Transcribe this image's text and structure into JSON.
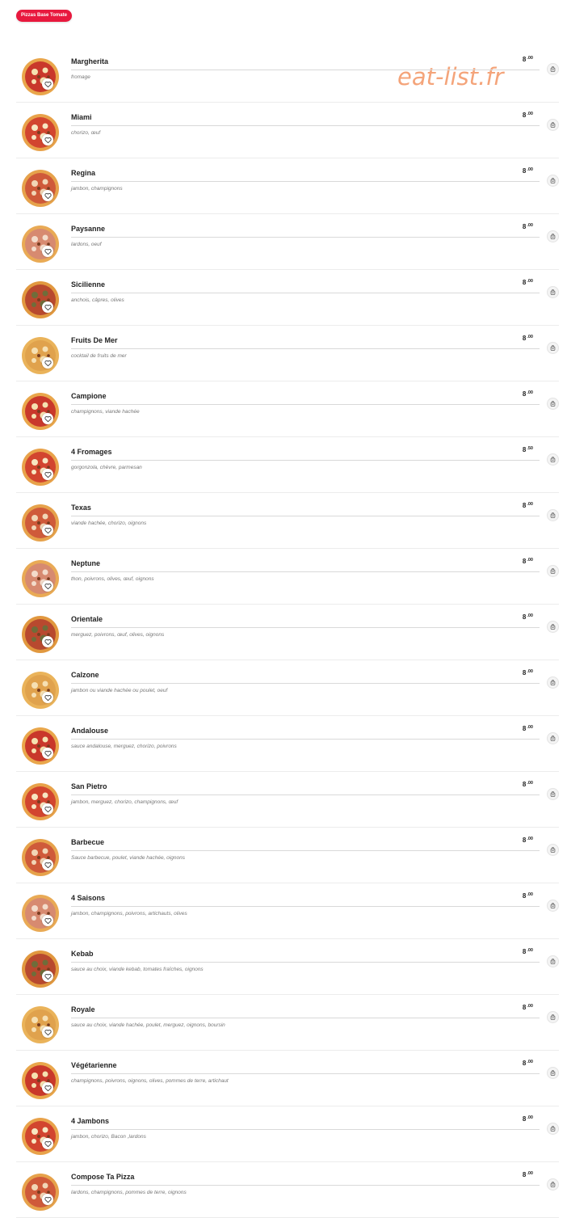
{
  "category": {
    "label": "Pizzas Base Tomate"
  },
  "watermark": "eat-list.fr",
  "items": [
    {
      "name": "Margherita",
      "description": "fromage",
      "price_main": "8",
      "price_cents": ".00"
    },
    {
      "name": "Miami",
      "description": "chorizo, œuf",
      "price_main": "8",
      "price_cents": ".00"
    },
    {
      "name": "Regina",
      "description": "jambon, champignons",
      "price_main": "8",
      "price_cents": ".00"
    },
    {
      "name": "Paysanne",
      "description": "lardons, oeuf",
      "price_main": "8",
      "price_cents": ".00"
    },
    {
      "name": "Sicilienne",
      "description": "anchois, câpres, olives",
      "price_main": "8",
      "price_cents": ".00"
    },
    {
      "name": "Fruits De Mer",
      "description": "cocktail de fruits de mer",
      "price_main": "8",
      "price_cents": ".00"
    },
    {
      "name": "Campione",
      "description": "champignons, viande hachée",
      "price_main": "8",
      "price_cents": ".00"
    },
    {
      "name": "4 Fromages",
      "description": "gorgonzola, chèvre, parmesan",
      "price_main": "8",
      "price_cents": ".50"
    },
    {
      "name": "Texas",
      "description": "viande hachée, chorizo, oignons",
      "price_main": "8",
      "price_cents": ".00"
    },
    {
      "name": "Neptune",
      "description": "thon, poivrons, olives, œuf, oignons",
      "price_main": "8",
      "price_cents": ".00"
    },
    {
      "name": "Orientale",
      "description": "merguez, poivrons, œuf, olives, oignons",
      "price_main": "8",
      "price_cents": ".00"
    },
    {
      "name": "Calzone",
      "description": "jambon ou viande hachée ou poulet, oeuf",
      "price_main": "8",
      "price_cents": ".00"
    },
    {
      "name": "Andalouse",
      "description": "sauce andalouse, merguez, chorizo, poivrons",
      "price_main": "8",
      "price_cents": ".00"
    },
    {
      "name": "San Pietro",
      "description": "jambon, merguez, chorizo, champignons, œuf",
      "price_main": "8",
      "price_cents": ".00"
    },
    {
      "name": "Barbecue",
      "description": "Sauce barbecue, poulet, viande hachée, oignons",
      "price_main": "8",
      "price_cents": ".00"
    },
    {
      "name": "4 Saisons",
      "description": "jambon, champignons, poivrons, artichauts, olives",
      "price_main": "8",
      "price_cents": ".00"
    },
    {
      "name": "Kebab",
      "description": "sauce au choix, viande kebab, tomates fraîches, oignons",
      "price_main": "8",
      "price_cents": ".00"
    },
    {
      "name": "Royale",
      "description": "sauce au choix, viande hachée, poulet, merguez, oignons, boursin",
      "price_main": "8",
      "price_cents": ".00"
    },
    {
      "name": "Végétarienne",
      "description": "champignons, poivrons, oignons, olives, pommes de terre, artichaut",
      "price_main": "8",
      "price_cents": ".00"
    },
    {
      "name": "4 Jambons",
      "description": "jambon, chorizo, Bacon ,lardons",
      "price_main": "8",
      "price_cents": ".00"
    },
    {
      "name": "Compose Ta Pizza",
      "description": "lardons, champignons, pommes de terre, oignons",
      "price_main": "8",
      "price_cents": ".00"
    }
  ],
  "icons": {
    "favorite": "heart-icon",
    "cart": "shopping-bag-icon",
    "thumbnail": "pizza-photo"
  },
  "colors": {
    "accent": "#e8193e",
    "watermark": "#f4a47a"
  }
}
